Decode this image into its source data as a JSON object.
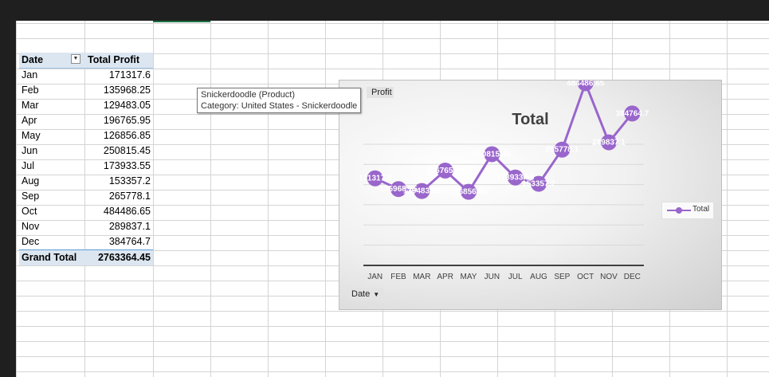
{
  "pivot": {
    "header_row_label": "Date",
    "header_value": "Total Profit",
    "rows": [
      {
        "label": "Jan",
        "value": "171317.6"
      },
      {
        "label": "Feb",
        "value": "135968.25"
      },
      {
        "label": "Mar",
        "value": "129483.05"
      },
      {
        "label": "Apr",
        "value": "196765.95"
      },
      {
        "label": "May",
        "value": "126856.85"
      },
      {
        "label": "Jun",
        "value": "250815.45"
      },
      {
        "label": "Jul",
        "value": "173933.55"
      },
      {
        "label": "Aug",
        "value": "153357.2"
      },
      {
        "label": "Sep",
        "value": "265778.1"
      },
      {
        "label": "Oct",
        "value": "484486.65"
      },
      {
        "label": "Nov",
        "value": "289837.1"
      },
      {
        "label": "Dec",
        "value": "384764.7"
      }
    ],
    "grand_total_label": "Grand Total",
    "grand_total_value": "2763364.45"
  },
  "tooltip": {
    "line1": "Snickerdoodle (Product)",
    "line2": "Category: United States - Snickerdoodle"
  },
  "chart": {
    "field_button": "Profit",
    "axis_field_button": "Date",
    "line_color": "#9966cc",
    "label_color": "#ffffff"
  },
  "chart_data": {
    "type": "line",
    "title": "Total",
    "categories": [
      "JAN",
      "FEB",
      "MAR",
      "APR",
      "MAY",
      "JUN",
      "JUL",
      "AUG",
      "SEP",
      "OCT",
      "NOV",
      "DEC"
    ],
    "series": [
      {
        "name": "Total",
        "values": [
          171317.6,
          135968.25,
          129483.05,
          196765.95,
          126856.85,
          250815.45,
          173933.55,
          153357.2,
          265778.1,
          484486.65,
          289837.1,
          384764.7
        ]
      }
    ],
    "data_labels": [
      "171317.6",
      "135968.25",
      "129483.05",
      "196765.95",
      "126856.85",
      "250815.45",
      "173933.55",
      "153357.2",
      "265778.1",
      "484486.65",
      "289837.1",
      "384764.7"
    ],
    "legend_position": "right",
    "grid": true
  }
}
